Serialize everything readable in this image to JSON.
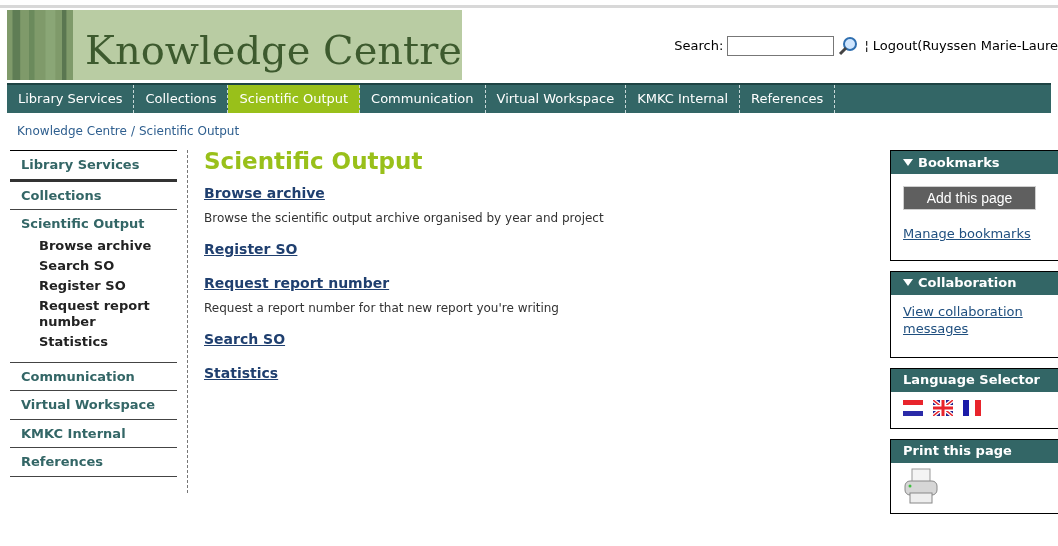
{
  "header": {
    "logo_text": "Knowledge Centre",
    "search": {
      "label": "Search:"
    },
    "separator": "¦",
    "logout": "Logout(Ruyssen Marie-Laure"
  },
  "nav": [
    {
      "label": "Library Services",
      "selected": false
    },
    {
      "label": "Collections",
      "selected": false
    },
    {
      "label": "Scientific Output",
      "selected": true
    },
    {
      "label": "Communication",
      "selected": false
    },
    {
      "label": "Virtual Workspace",
      "selected": false
    },
    {
      "label": "KMKC Internal",
      "selected": false
    },
    {
      "label": "References",
      "selected": false
    }
  ],
  "breadcrumb": {
    "items": [
      "Knowledge Centre",
      "Scientific Output"
    ],
    "separator": "/"
  },
  "sidebar": {
    "items": [
      {
        "label": "Library Services"
      },
      {
        "label": "Collections"
      },
      {
        "label": "Scientific Output",
        "children": [
          {
            "label": "Browse archive"
          },
          {
            "label": "Search SO"
          },
          {
            "label": "Register SO"
          },
          {
            "label": "Request report number"
          },
          {
            "label": "Statistics"
          }
        ]
      },
      {
        "label": "Communication"
      },
      {
        "label": "Virtual Workspace"
      },
      {
        "label": "KMKC Internal"
      },
      {
        "label": "References"
      }
    ]
  },
  "main": {
    "title": "Scientific Output",
    "links": [
      {
        "label": "Browse archive",
        "description": "Browse the scientific output archive organised by year and project"
      },
      {
        "label": "Register SO"
      },
      {
        "label": "Request report number",
        "description": "Request a report number for that new report you're writing"
      },
      {
        "label": "Search SO"
      },
      {
        "label": "Statistics"
      }
    ]
  },
  "panels": [
    {
      "kind": "bookmarks",
      "title": "Bookmarks",
      "expanded": true,
      "button": "Add this page",
      "link": "Manage bookmarks"
    },
    {
      "kind": "link",
      "title": "Collaboration",
      "expanded": true,
      "link": "View collaboration messages"
    },
    {
      "kind": "flags",
      "title": "Language Selector",
      "expanded": false
    },
    {
      "kind": "print",
      "title": "Print this page",
      "expanded": false
    }
  ]
}
